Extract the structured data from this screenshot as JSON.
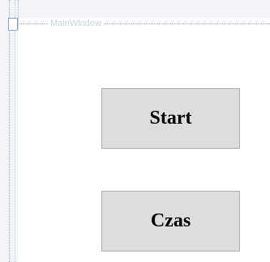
{
  "window": {
    "title": "MainWindow"
  },
  "buttons": {
    "start_label": "Start",
    "czas_label": "Czas"
  }
}
